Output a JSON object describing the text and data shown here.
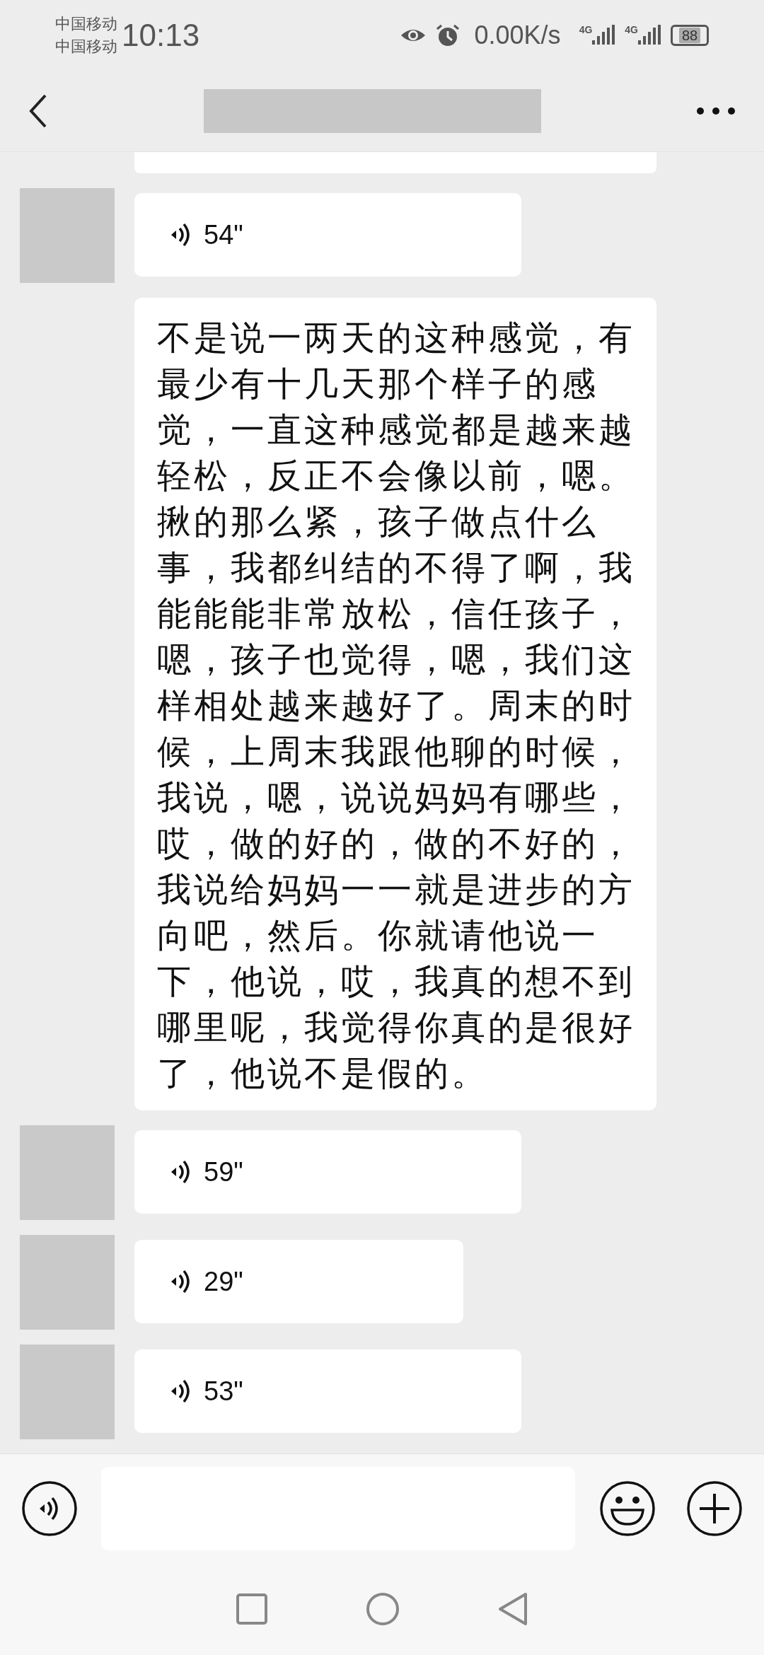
{
  "status_bar": {
    "carriers": [
      "中国移动",
      "中国移动"
    ],
    "time": "10:13",
    "net_speed": "0.00K/s",
    "signals": [
      "4G",
      "4G"
    ],
    "battery": "88"
  },
  "messages": [
    {
      "kind": "partial"
    },
    {
      "kind": "voice",
      "avatar": true,
      "duration": "54\""
    },
    {
      "kind": "text",
      "avatar": false,
      "text": "不是说一两天的这种感觉，有最少有十几天那个样子的感觉，一直这种感觉都是越来越轻松，反正不会像以前，嗯。揪的那么紧，孩子做点什么事，我都纠结的不得了啊，我能能能非常放松，信任孩子，嗯，孩子也觉得，嗯，我们这样相处越来越好了。周末的时候，上周末我跟他聊的时候，我说，嗯，说说妈妈有哪些，哎，做的好的，做的不好的，我说给妈妈一一就是进步的方向吧，然后。你就请他说一下，他说，哎，我真的想不到哪里呢，我觉得你真的是很好了，他说不是假的。"
    },
    {
      "kind": "voice",
      "avatar": true,
      "duration": "59\""
    },
    {
      "kind": "voice",
      "avatar": true,
      "duration": "29\""
    },
    {
      "kind": "voice",
      "avatar": true,
      "duration": "53\""
    }
  ]
}
